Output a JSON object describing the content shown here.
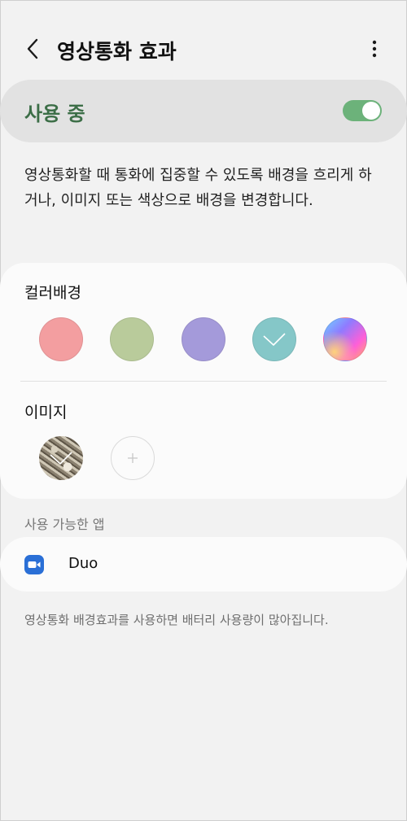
{
  "header": {
    "title": "영상통화 효과",
    "back_icon": "chevron-left-icon",
    "more_icon": "more-vertical-icon"
  },
  "master_toggle": {
    "label": "사용 중",
    "state": "on",
    "color": "#6cb27a",
    "label_color": "#3c6e47"
  },
  "description": "영상통화할 때 통화에 집중할 수 있도록 배경을 흐리게 하거나, 이미지 또는 색상으로 배경을 변경합니다.",
  "color_background": {
    "label": "컬러배경",
    "swatches": [
      {
        "color": "#f39ea0",
        "selected": false
      },
      {
        "color": "#b9cb9b",
        "selected": false
      },
      {
        "color": "#a49ada",
        "selected": false
      },
      {
        "color": "#85c7c8",
        "selected": true
      },
      {
        "color": "gradient",
        "selected": false
      }
    ]
  },
  "image_background": {
    "label": "이미지",
    "selected_image_icon": "checkmark-icon",
    "add_icon": "plus-icon"
  },
  "available_apps": {
    "header": "사용 가능한 앱",
    "apps": [
      {
        "name": "Duo",
        "icon": "duo-video-icon",
        "icon_color": "#2a6fd6"
      }
    ]
  },
  "footer_note": "영상통화 배경효과를 사용하면 배터리 사용량이 많아집니다."
}
